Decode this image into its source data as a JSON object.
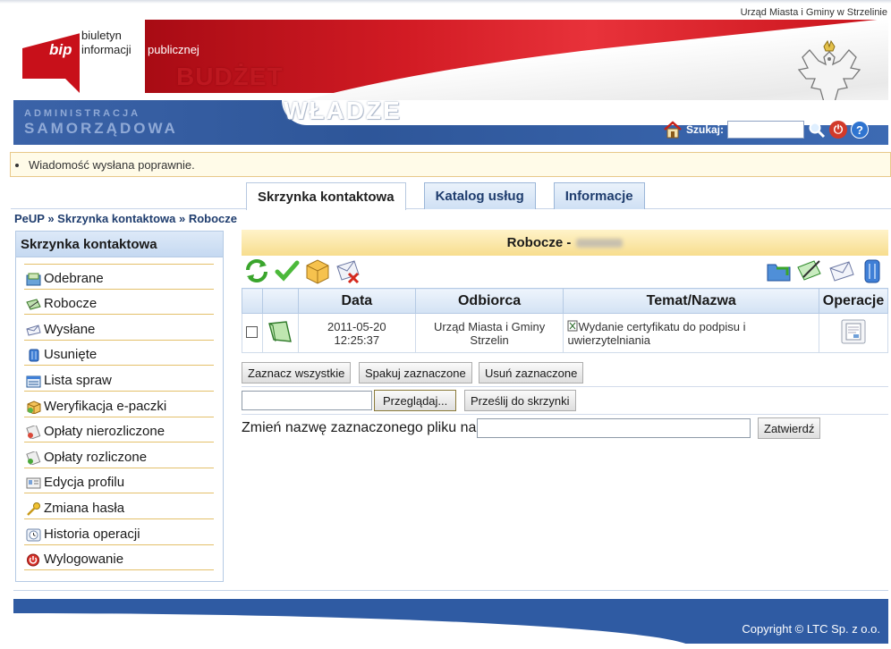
{
  "header": {
    "organization": "Urząd Miasta i Gminy w Strzelinie",
    "bip_logo": "bip",
    "bip_line1": "biuletyn",
    "bip_line2": "informacji",
    "bip_line3": "publicznej",
    "banner_word1": "BUDŻET",
    "banner_word2": "WŁADZE",
    "admin_line1": "ADMINISTRACJA",
    "admin_line2": "SAMORZĄDOWA",
    "search_label": "Szukaj:",
    "search_value": ""
  },
  "message": "Wiadomość wysłana poprawnie.",
  "tabs": [
    {
      "label": "Skrzynka kontaktowa"
    },
    {
      "label": "Katalog usług"
    },
    {
      "label": "Informacje"
    }
  ],
  "breadcrumb": "PeUP » Skrzynka kontaktowa » Robocze",
  "sidebar": {
    "title": "Skrzynka kontaktowa",
    "items": [
      {
        "label": "Odebrane",
        "icon": "inbox-icon"
      },
      {
        "label": "Robocze",
        "icon": "draft-icon"
      },
      {
        "label": "Wysłane",
        "icon": "sent-icon"
      },
      {
        "label": "Usunięte",
        "icon": "trash-icon"
      },
      {
        "label": "Lista spraw",
        "icon": "case-list-icon"
      },
      {
        "label": "Weryfikacja e-paczki",
        "icon": "package-verify-icon"
      },
      {
        "label": "Opłaty nierozliczone",
        "icon": "unsettled-fees-icon"
      },
      {
        "label": "Opłaty rozliczone",
        "icon": "settled-fees-icon"
      },
      {
        "label": "Edycja profilu",
        "icon": "profile-edit-icon"
      },
      {
        "label": "Zmiana hasła",
        "icon": "key-icon"
      },
      {
        "label": "Historia operacji",
        "icon": "history-icon"
      },
      {
        "label": "Wylogowanie",
        "icon": "logout-icon"
      }
    ]
  },
  "main": {
    "title": "Robocze -",
    "table": {
      "headers": [
        "Data",
        "Odbiorca",
        "Temat/Nazwa",
        "Operacje"
      ],
      "rows": [
        {
          "date": "2011-05-20",
          "time": "12:25:37",
          "recipient": "Urząd Miasta i Gminy Strzelin",
          "subject": "Wydanie certyfikatu do podpisu i uwierzytelniania"
        }
      ]
    },
    "buttons": {
      "select_all": "Zaznacz wszystkie",
      "pack_selected": "Spakuj zaznaczone",
      "delete_selected": "Usuń zaznaczone",
      "browse": "Przeglądaj...",
      "send_to_box": "Prześlij do skrzynki",
      "confirm": "Zatwierdź"
    },
    "rename_label": "Zmień nazwę zaznaczonego pliku na:"
  },
  "footer": {
    "copyright": "Copyright © LTC Sp. z o.o."
  }
}
